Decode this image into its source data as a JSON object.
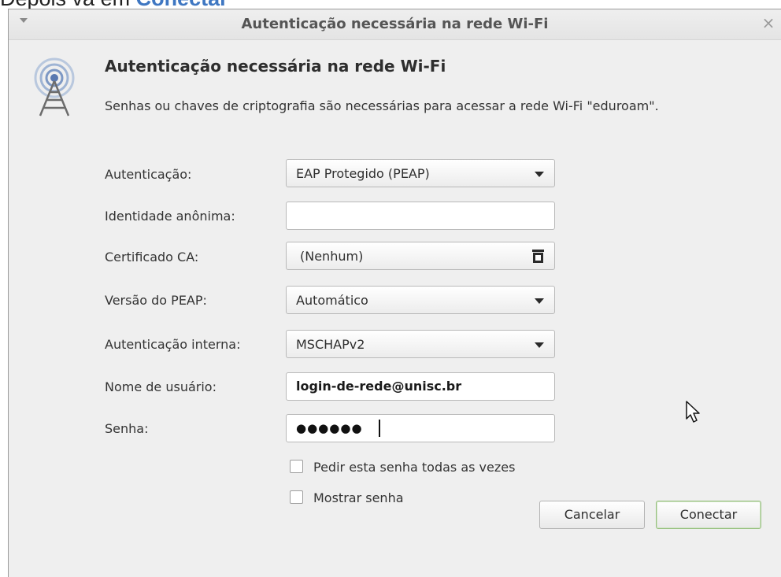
{
  "caption": {
    "text": "Depois vá em ",
    "link": "Conectar"
  },
  "window": {
    "title": "Autenticação necessária na rede Wi-Fi",
    "close_glyph": "×",
    "menu_icon": "chevron-down-icon"
  },
  "dialog": {
    "heading": "Autenticação necessária na rede Wi-Fi",
    "description": "Senhas ou chaves de criptografia são necessárias para acessar a rede Wi-Fi \"eduroam\".",
    "icon": "wifi-tower-icon"
  },
  "form": {
    "authentication": {
      "label": "Autenticação:",
      "value": "EAP Protegido (PEAP)"
    },
    "anonymous_identity": {
      "label": "Identidade anônima:",
      "value": ""
    },
    "ca_certificate": {
      "label": "Certificado CA:",
      "value": "(Nenhum)",
      "icon": "document-icon"
    },
    "peap_version": {
      "label": "Versão do PEAP:",
      "value": "Automático"
    },
    "inner_authentication": {
      "label": "Autenticação interna:",
      "value": "MSCHAPv2"
    },
    "username": {
      "label": "Nome de usuário:",
      "value": "login-de-rede@unisc.br"
    },
    "password": {
      "label": "Senha:",
      "masked_value": "●●●●●●"
    },
    "ask_every_time": {
      "label": "Pedir esta senha todas as vezes",
      "checked": false
    },
    "show_password": {
      "label": "Mostrar senha",
      "checked": false
    }
  },
  "buttons": {
    "cancel": "Cancelar",
    "connect": "Conectar"
  }
}
